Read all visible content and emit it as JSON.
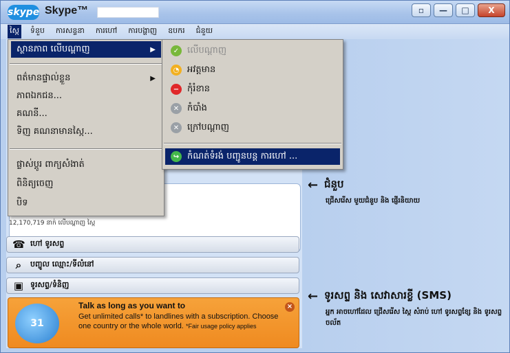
{
  "window": {
    "logo_text": "skype",
    "title": "Skype™",
    "buttons": {
      "restore": "▫",
      "minimize": "—",
      "maximize": "□",
      "close": "X"
    }
  },
  "menubar": [
    "ស្កៃ",
    "ទំនួប",
    "ការសន្ទនា",
    "ការហៅ",
    "ការបង្ហាញ",
    "ឧបករ",
    "ជំនួយ"
  ],
  "skype_menu": {
    "items": [
      {
        "label": "ស្ថានភាព លើបណ្តាញ",
        "submenu": true,
        "highlighted": true
      },
      {
        "label": "ពត៌មានផ្ទាល់ខ្លួន",
        "submenu": true
      },
      {
        "label": "ភាពឯកជន..."
      },
      {
        "label": "គណនី..."
      },
      {
        "label": "ទិញ គណនាមាន​ស្កៃ..."
      },
      {
        "label": "ផ្លាស់ប្តូរ ពាក្យសំងាត់"
      },
      {
        "label": "ពិនិត្យចេញ"
      },
      {
        "label": "បិទ"
      }
    ]
  },
  "status_menu": {
    "items": [
      {
        "icon": "online-status-icon",
        "glyph": "✓",
        "label": "លើបណ្តាញ",
        "disabled": true
      },
      {
        "icon": "away-status-icon",
        "glyph": "◔",
        "label": "អវត្តមាន"
      },
      {
        "icon": "do-not-disturb-status-icon",
        "glyph": "−",
        "label": "កុំរំខាន"
      },
      {
        "icon": "invisible-status-icon",
        "glyph": "✕",
        "label": "កំបាំង"
      },
      {
        "icon": "offline-status-icon",
        "glyph": "✕",
        "label": "ក្រៅបណ្តាញ"
      },
      {
        "icon": "call-forwarding-icon",
        "glyph": "↪",
        "label": "កំណត់ទំរង់ បញ្ជូនបន្ត ការហៅ ...",
        "highlighted": true
      }
    ]
  },
  "left_pane": {
    "online_count": "12,170,719 នាក់ លើបណ្តាញ ស្កៃ",
    "actions": [
      {
        "icon": "phone-icon",
        "glyph": "☎",
        "label": "ហៅ ទូរសព្ទ"
      },
      {
        "icon": "search-icon",
        "glyph": "⌕",
        "label": "បញ្ចូល ឈ្មោះ/ទីលំនៅ"
      },
      {
        "icon": "shop-bag-icon",
        "glyph": "▣",
        "label": "ទូរសព្ទ/ទំនិញ"
      }
    ],
    "promo": {
      "icon_text": "31",
      "title": "Talk as long as you want to",
      "body": "Get unlimited calls* to landlines with a subscription. Choose one country or the whole world.",
      "footnote": "*Fair usage policy applies",
      "close": "×"
    }
  },
  "right_pane": {
    "features": [
      {
        "arrow": "←",
        "title": "ជំនួប",
        "desc": "ជ្រើសរើស មួយជំនួប និង ផ្ញើរនិយាយ"
      },
      {
        "arrow": "←",
        "title": "ទូរសព្ទ និង សេវាសារខ្លី (SMS)",
        "desc": "អ្នក អាចហៅដែល ជ្រើសរើស ស្កៃ សំរាប់ ហៅ ទូរសព្ទខ្សែ និង ទូរសព្ទចល័ត"
      }
    ]
  },
  "colors": {
    "menu_highlight": "#0a246a",
    "promo_orange": "#ef8a20",
    "window_blue": "#b8cfee"
  }
}
